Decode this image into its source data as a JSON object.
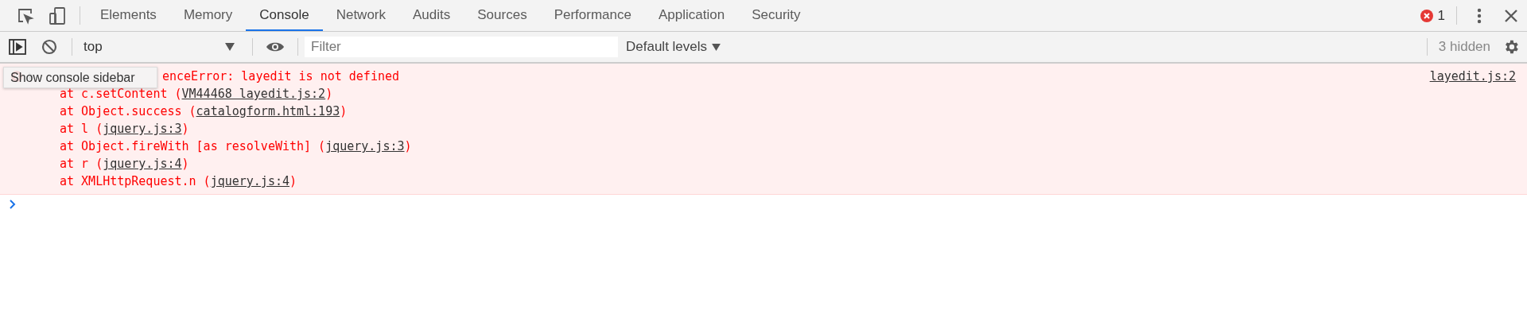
{
  "tabs": [
    {
      "label": "Elements",
      "selected": false
    },
    {
      "label": "Memory",
      "selected": false
    },
    {
      "label": "Console",
      "selected": true
    },
    {
      "label": "Network",
      "selected": false
    },
    {
      "label": "Audits",
      "selected": false
    },
    {
      "label": "Sources",
      "selected": false
    },
    {
      "label": "Performance",
      "selected": false
    },
    {
      "label": "Application",
      "selected": false
    },
    {
      "label": "Security",
      "selected": false
    }
  ],
  "error_count": "1",
  "toolbar": {
    "context": "top",
    "filter": {
      "placeholder": "Filter"
    },
    "levels": "Default levels",
    "hidden": "3 hidden"
  },
  "tooltip": "Show console sidebar",
  "error": {
    "message": "enceError: layedit is not defined",
    "source": "layedit.js:2",
    "frames": [
      {
        "before": "at c.setContent (",
        "link": "VM44468 layedit.js:2",
        "after": ")"
      },
      {
        "before": "at Object.success (",
        "link": "catalogform.html:193",
        "after": ")"
      },
      {
        "before": "at l (",
        "link": "jquery.js:3",
        "after": ")"
      },
      {
        "before": "at Object.fireWith [as resolveWith] (",
        "link": "jquery.js:3",
        "after": ")"
      },
      {
        "before": "at r (",
        "link": "jquery.js:4",
        "after": ")"
      },
      {
        "before": "at XMLHttpRequest.n (",
        "link": "jquery.js:4",
        "after": ")"
      }
    ]
  }
}
